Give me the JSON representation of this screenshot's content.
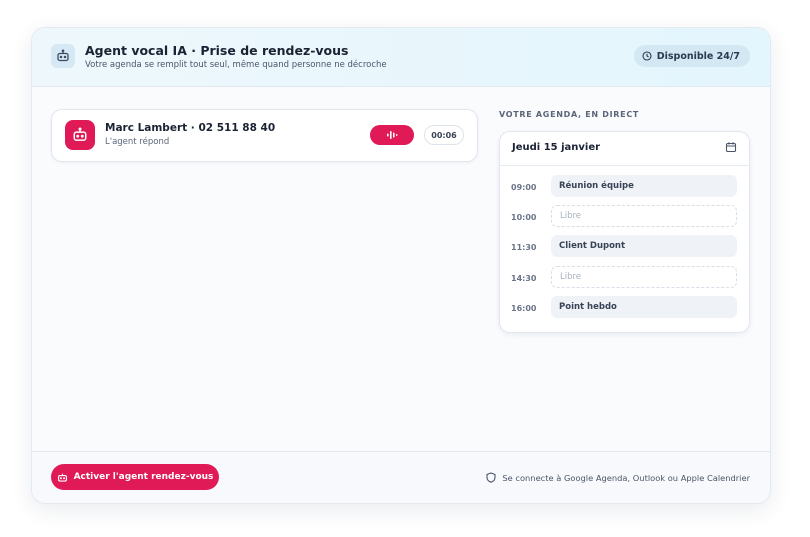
{
  "header": {
    "title": "Agent vocal IA · Prise de rendez-vous",
    "subtitle": "Votre agenda se remplit tout seul, même quand personne ne décroche",
    "badge": "Disponible 24/7",
    "icon": "robot-icon"
  },
  "call": {
    "name": "Marc Lambert · 02 511 88 40",
    "status": "L'agent répond",
    "timer": "00:06",
    "avatar_icon": "robot-icon",
    "wave_icon": "audio-wave-icon"
  },
  "agenda": {
    "label": "VOTRE AGENDA, EN DIRECT",
    "date": "Jeudi 15 janvier",
    "slots": [
      {
        "time": "09:00",
        "label": "Réunion équipe",
        "status": "busy"
      },
      {
        "time": "10:00",
        "label": "Libre",
        "status": "free"
      },
      {
        "time": "11:30",
        "label": "Client Dupont",
        "status": "busy"
      },
      {
        "time": "14:30",
        "label": "Libre",
        "status": "free"
      },
      {
        "time": "16:00",
        "label": "Point hebdo",
        "status": "busy"
      }
    ]
  },
  "footer": {
    "cta_label": "Activer l'agent rendez-vous",
    "note": "Se connecte à Google Agenda, Outlook ou Apple Calendrier"
  },
  "colors": {
    "accent": "#df1a57",
    "header_bg": "#e3f5fd",
    "badge_bg": "#d3e8f3"
  }
}
